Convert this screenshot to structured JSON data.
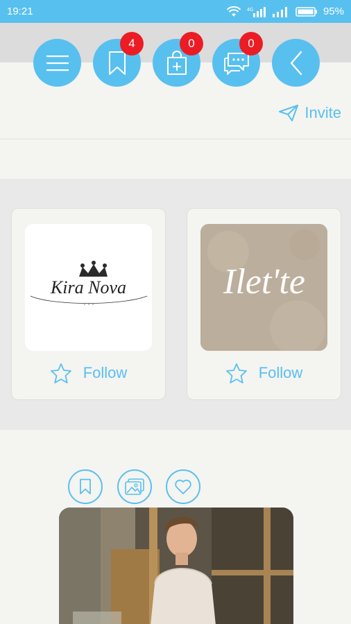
{
  "status": {
    "time": "19:21",
    "network": "4G",
    "battery": "95%"
  },
  "nav": {
    "menu_icon": "hamburger-icon",
    "bookmarks_badge": "4",
    "cart_badge": "0",
    "messages_badge": "0",
    "back_icon": "chevron-left-icon"
  },
  "invite_label": "Invite",
  "brands": [
    {
      "logo_text": "Kira Nova",
      "follow_label": "Follow"
    },
    {
      "logo_text": "Ilet'te",
      "follow_label": "Follow"
    }
  ],
  "colors": {
    "accent": "#58c0ef",
    "badge": "#ec1c24"
  }
}
